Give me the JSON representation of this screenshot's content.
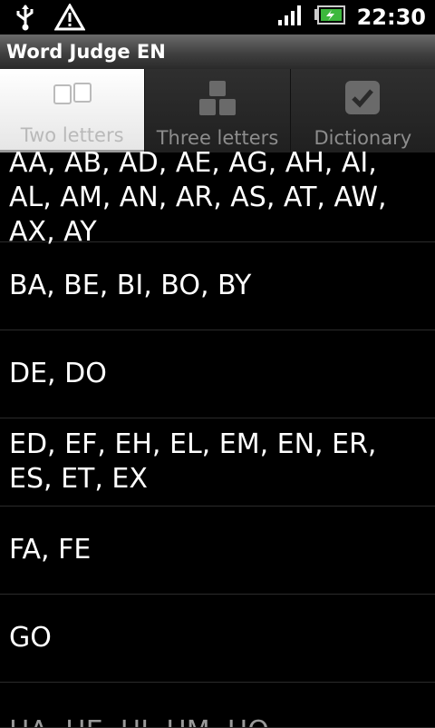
{
  "status_bar": {
    "time": "22:30",
    "icons": [
      "usb-icon",
      "warning-icon",
      "signal-icon",
      "battery-icon"
    ]
  },
  "app": {
    "title": "Word Judge EN"
  },
  "tabs": [
    {
      "label": "Two letters",
      "selected": true,
      "icon": "two-squares-icon"
    },
    {
      "label": "Three letters",
      "selected": false,
      "icon": "three-squares-icon"
    },
    {
      "label": "Dictionary",
      "selected": false,
      "icon": "checkbox-icon"
    }
  ],
  "words": [
    "AA, AB, AD, AE, AG, AH, AI, AL, AM, AN, AR, AS, AT, AW, AX, AY",
    "BA, BE, BI, BO, BY",
    "DE, DO",
    "ED, EF, EH, EL, EM, EN, ER, ES, ET, EX",
    "FA, FE",
    "GO",
    "HA, HE, HI, HM, HO"
  ],
  "colors": {
    "background": "#000000",
    "text": "#ffffff",
    "divider": "#2b2b2b"
  }
}
